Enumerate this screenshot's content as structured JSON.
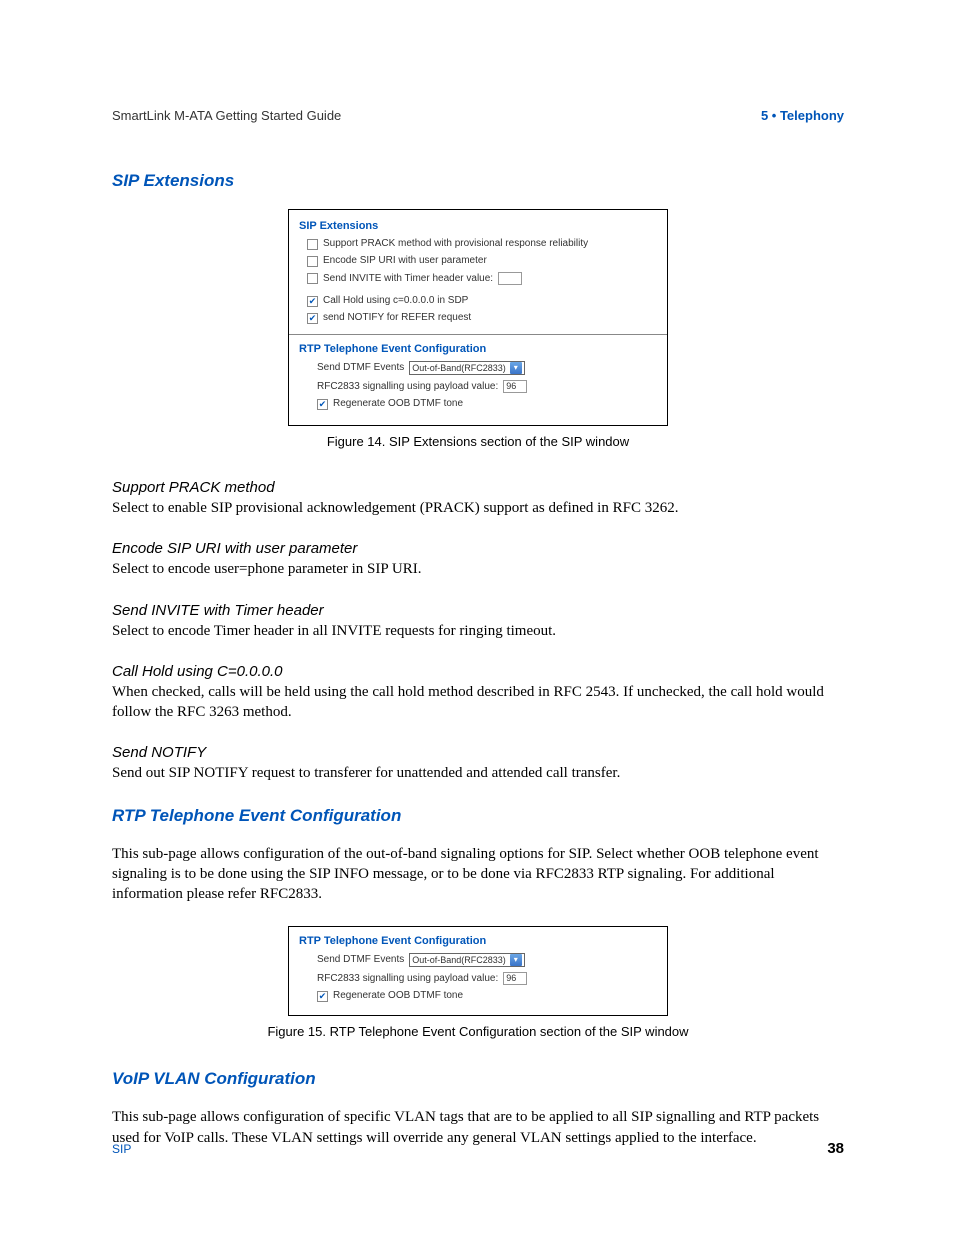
{
  "header": {
    "left": "SmartLink M-ATA Getting Started Guide",
    "right": "5 • Telephony"
  },
  "section1": {
    "title": "SIP Extensions"
  },
  "figure1": {
    "sipExtTitle": "SIP Extensions",
    "row1": "Support PRACK method with provisional response reliability",
    "row2": "Encode SIP URI with user parameter",
    "row3": "Send INVITE with Timer header value:",
    "row3val": "",
    "row4": "Call Hold using c=0.0.0.0 in SDP",
    "row5": "send NOTIFY for REFER request",
    "rtpTitle": "RTP Telephone Event Configuration",
    "rtp1label": "Send DTMF Events",
    "rtp1select": "Out-of-Band(RFC2833)",
    "rtp2label": "RFC2833 signalling using payload value:",
    "rtp2val": "96",
    "rtp3": "Regenerate OOB DTMF tone",
    "caption": "Figure 14. SIP Extensions section of the SIP window"
  },
  "definitions": [
    {
      "head": "Support PRACK method",
      "body": "Select to enable SIP provisional acknowledgement (PRACK) support as defined in RFC 3262."
    },
    {
      "head": "Encode SIP URI with user parameter",
      "body": "Select to encode user=phone parameter in SIP URI."
    },
    {
      "head": "Send INVITE with Timer header",
      "body": "Select to encode Timer header in all INVITE requests for ringing timeout."
    },
    {
      "head": "Call Hold using C=0.0.0.0",
      "body": "When checked, calls will be held using the call hold method described in RFC 2543. If unchecked, the call hold would follow the RFC 3263 method."
    },
    {
      "head": "Send NOTIFY",
      "body": "Send out SIP NOTIFY request to transferer for unattended and attended call transfer."
    }
  ],
  "section2": {
    "title": "RTP Telephone Event Configuration",
    "body": "This sub-page allows configuration of the out-of-band signaling options for SIP. Select whether OOB telephone event signaling is to be done using the SIP INFO message, or to be done via RFC2833 RTP signaling. For additional information please refer RFC2833."
  },
  "figure2": {
    "rtpTitle": "RTP Telephone Event Configuration",
    "rtp1label": "Send DTMF Events",
    "rtp1select": "Out-of-Band(RFC2833)",
    "rtp2label": "RFC2833 signalling using payload value:",
    "rtp2val": "96",
    "rtp3": "Regenerate OOB DTMF tone",
    "caption": "Figure 15. RTP Telephone Event Configuration section of the SIP window"
  },
  "section3": {
    "title": "VoIP VLAN Configuration",
    "body": "This sub-page allows configuration of specific VLAN tags that are to be applied to all SIP signalling and RTP packets used for VoIP calls. These VLAN settings will override any general VLAN settings applied to the interface."
  },
  "footer": {
    "left": "SIP",
    "right": "38"
  }
}
